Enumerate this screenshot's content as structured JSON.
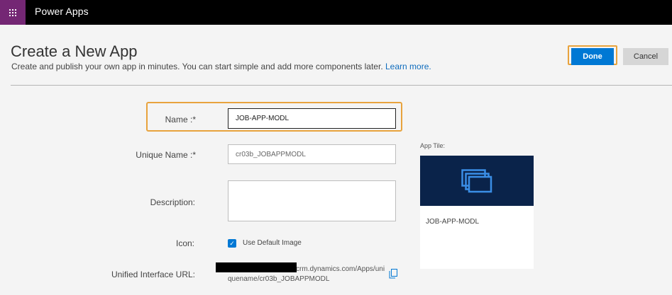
{
  "header": {
    "app_name": "Power Apps",
    "waffle_icon": "app-launcher-icon"
  },
  "page": {
    "title": "Create a New App",
    "subtitle": "Create and publish your own app in minutes. You can start simple and add more components later.",
    "learn_more": "Learn more."
  },
  "actions": {
    "done_label": "Done",
    "cancel_label": "Cancel"
  },
  "form": {
    "name_label": "Name :*",
    "name_value": "JOB-APP-MODL",
    "unique_name_label": "Unique Name :*",
    "unique_name_value": "cr03b_JOBAPPMODL",
    "description_label": "Description:",
    "description_value": "",
    "icon_label": "Icon:",
    "use_default_image_label": "Use Default Image",
    "use_default_image_checked": true,
    "url_label": "Unified Interface URL:",
    "url_line1": "crm.dynamics.com/Apps/uni",
    "url_line2": "quename/cr03b_JOBAPPMODL"
  },
  "tile": {
    "label": "App Tile:",
    "name": "JOB-APP-MODL",
    "icon": "app-tile-icon"
  },
  "colors": {
    "top_bar": "#000000",
    "waffle": "#742774",
    "primary": "#0078d4",
    "highlight": "#e8a33d",
    "tile_background": "#0a234a"
  }
}
